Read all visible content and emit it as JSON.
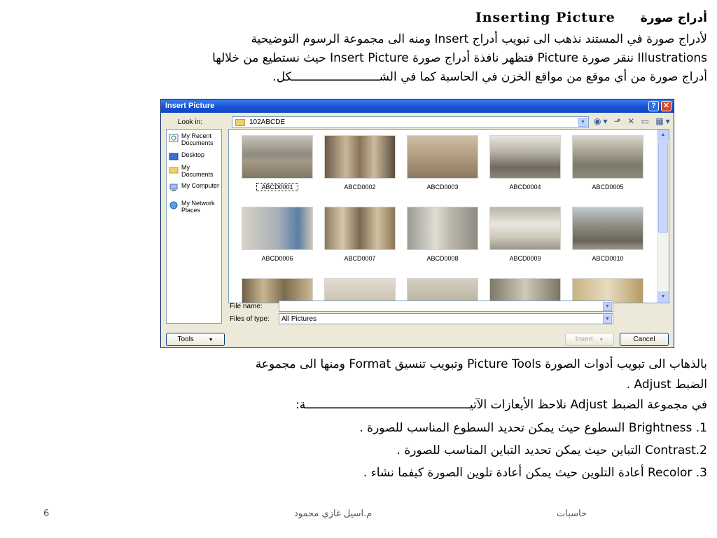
{
  "heading": {
    "arabic": "أدراج صورة",
    "english": "Inserting  Picture"
  },
  "intro_lines": [
    "لأدراج صورة في المستند نذهب الى تبويب أدراج  Insert ومنه الى مجموعة الرسوم التوضيحية",
    "Illustrations ننقر صورة Picture فتظهر نافذة أدراج صورة  Insert Picture حيث نستطيع من خلالها",
    "أدراج صورة من أي موقع من مواقع الخزن في الحاسبة كما في الشـــــــــــــــــــــــــكل."
  ],
  "dialog": {
    "title": "Insert Picture",
    "look_in_label": "Look in:",
    "look_in_value": "102ABCDE",
    "places": [
      "My Recent Documents",
      "Desktop",
      "My Documents",
      "My Computer",
      "My Network Places"
    ],
    "files": [
      "ABCD0001",
      "ABCD0002",
      "ABCD0003",
      "ABCD0004",
      "ABCD0005",
      "ABCD0006",
      "ABCD0007",
      "ABCD0008",
      "ABCD0009",
      "ABCD0010"
    ],
    "file_name_label": "File name:",
    "file_name_value": "",
    "files_of_type_label": "Files of type:",
    "files_of_type_value": "All Pictures",
    "tools_label": "Tools",
    "insert_label": "Insert",
    "cancel_label": "Cancel"
  },
  "body_lines": [
    "بالذهاب الى تبويب أدوات الصورة  Picture Tools  وتبويب تنسيق  Format ومنها الى مجموعة",
    "الضبط  Adjust .",
    "في مجموعة الضبط  Adjust نلاحظ الأيعازات الآتيـــــــــــــــــــــــــــــــــــــــــــــــة:",
    "Brightness .1  السطوع حيث يمكن تحديد السطوع المناسب للصورة .",
    "Contrast.2  التباين حيث يمكن تحديد التباين المناسب للصورة .",
    "Recolor .3  أعادة التلوين  حيث يمكن أعادة تلوين الصورة كيفما نشاء ."
  ],
  "footer": {
    "page": "6",
    "author": "م.اسيل غازي محمود",
    "course": "حاسبات"
  },
  "colors": {
    "titlebar": "#1a55d6",
    "dialog_bg": "#ece9d8",
    "close": "#d9472b"
  }
}
